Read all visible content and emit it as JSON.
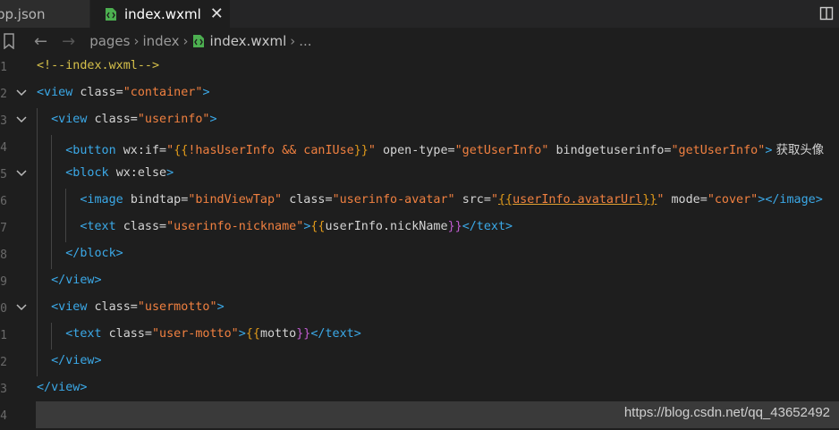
{
  "tabs": [
    {
      "label": "pp.json",
      "active": false
    },
    {
      "label": "index.wxml",
      "active": true,
      "close": "✕"
    }
  ],
  "breadcrumb": [
    "pages",
    "index",
    "index.wxml",
    "..."
  ],
  "line_numbers": [
    "1",
    "2",
    "3",
    "4",
    "5",
    "6",
    "7",
    "8",
    "9",
    "0",
    "1",
    "2",
    "3",
    "4"
  ],
  "code": {
    "l1_comment": "<!--index.wxml-->",
    "view_open": "<view",
    "view_close": "</view>",
    "class": "class=",
    "container": "\"container\"",
    "userinfo": "\"userinfo\"",
    "gt": ">",
    "button_open": "<button",
    "wxif": "wx:if=",
    "q": "\"",
    "lbr": "{{",
    "rbr": "}}",
    "cond": "!hasUserInfo && canIUse",
    "opentype": "open-type=",
    "getUserInfo": "\"getUserInfo\"",
    "bindgetuserinfo": "bindgetuserinfo=",
    "button_text": " 获取头像",
    "block_open": "<block",
    "wxelse": "wx:else",
    "image_open": "<image",
    "bindtap": "bindtap=",
    "bindViewTap": "\"bindViewTap\"",
    "avatar_class": "\"userinfo-avatar\"",
    "src": "src=",
    "avatar_expr": "userInfo.avatarUrl",
    "mode": "mode=",
    "cover": "\"cover\"",
    "image_close": "</image>",
    "text_open": "<text",
    "nickname_class": "\"userinfo-nickname\"",
    "nickname_expr": "userInfo.nickName",
    "text_close": "</text>",
    "block_close": "</block>",
    "usermotto": "\"usermotto\"",
    "user_motto": "\"user-motto\"",
    "motto": "motto"
  },
  "watermark": "https://blog.csdn.net/qq_43652492",
  "colors": {
    "tag": "#3ba9e8",
    "string": "#f08040",
    "comment": "#d6c04a",
    "bracket1": "#e09a1a",
    "bracket2": "#c05cd0"
  }
}
